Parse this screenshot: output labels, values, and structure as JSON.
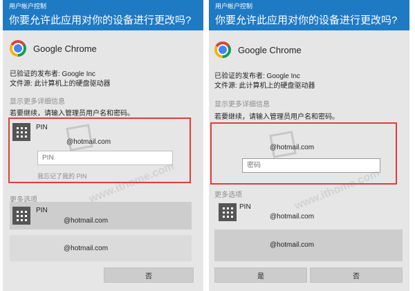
{
  "left": {
    "window_title": "用户帐户控制",
    "question": "你要允许此应用对你的设备进行更改吗?",
    "app_name": "Google Chrome",
    "publisher": "已验证的发布者: Google Inc",
    "file_origin": "文件源: 此计算机上的硬盘驱动器",
    "show_details": "显示更多详细信息",
    "instruction": "若要继续，请输入管理员用户名和密码。",
    "account": {
      "label": "PIN",
      "email": "@hotmail.com",
      "pin_placeholder": "PIN",
      "forgot": "我忘记了我的 PIN"
    },
    "more_options": "更多选项",
    "options": [
      {
        "label": "PIN",
        "email": "@hotmail.com"
      },
      {
        "email": "@hotmail.com"
      }
    ],
    "no_button": "否"
  },
  "right": {
    "window_title": "用户帐户控制",
    "question": "你要允许此应用对你的设备进行更改吗?",
    "app_name": "Google Chrome",
    "publisher": "已验证的发布者: Google Inc",
    "file_origin": "文件源: 此计算机上的硬盘驱动器",
    "show_details": "显示更多详细信息",
    "instruction": "若要继续，请输入管理员用户名和密码。",
    "account": {
      "email": "@hotmail.com",
      "password_placeholder": "密码"
    },
    "more_options": "更多选项",
    "options": [
      {
        "label": "PIN",
        "email": "@hotmail.com"
      },
      {
        "email": "@hotmail.com"
      }
    ],
    "yes_button": "是",
    "no_button": "否"
  },
  "watermark": "www.ithome.com",
  "colors": {
    "header": "#1f7ac4",
    "dialog_bg": "#e6e6e6",
    "highlight": "#e03c3c"
  }
}
